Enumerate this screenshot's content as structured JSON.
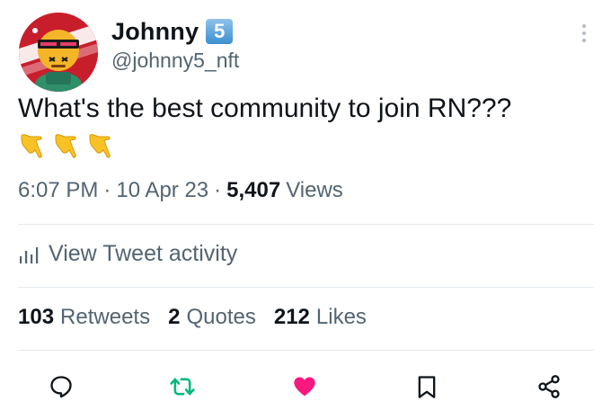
{
  "author": {
    "display_name": "Johnny",
    "badge": "5",
    "handle": "@johnny5_nft"
  },
  "tweet": {
    "text": "What's the best community to join RN???",
    "emojis": [
      "backhand-index-pointing-down",
      "backhand-index-pointing-down",
      "backhand-index-pointing-down"
    ]
  },
  "meta": {
    "time": "6:07 PM",
    "date": "10 Apr 23",
    "views_count": "5,407",
    "views_label": "Views",
    "separator": "·"
  },
  "activity_label": "View Tweet activity",
  "stats": [
    {
      "count": "103",
      "label": "Retweets"
    },
    {
      "count": "2",
      "label": "Quotes"
    },
    {
      "count": "212",
      "label": "Likes"
    }
  ],
  "actions": [
    "reply-icon",
    "retweet-icon",
    "like-icon",
    "bookmark-icon",
    "share-icon"
  ],
  "colors": {
    "text_primary": "#0f1419",
    "text_secondary": "#536471",
    "divider": "#e5e9ec",
    "retweet": "#00ba7c",
    "like": "#f91880",
    "icon_default": "#0f1419",
    "badge": "#3c8fd1",
    "avatar_bg": "#c81e2b"
  }
}
